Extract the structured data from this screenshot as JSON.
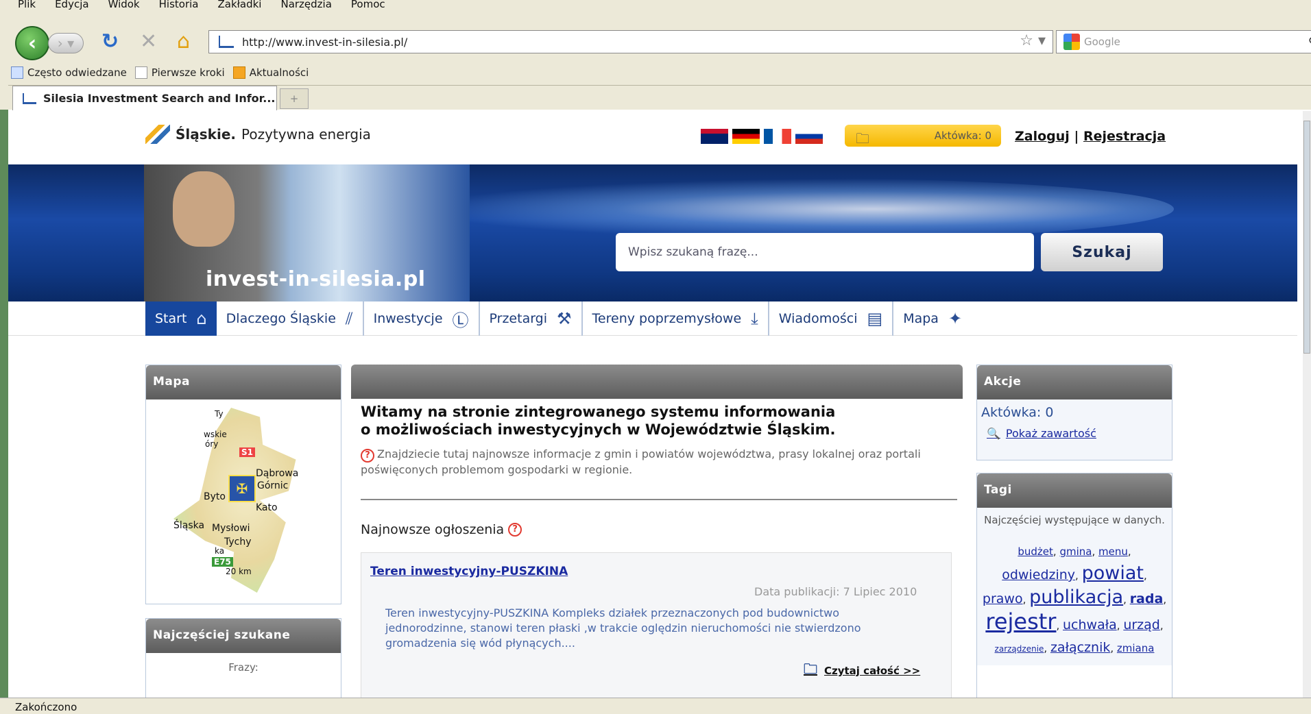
{
  "browser": {
    "menu": [
      "Plik",
      "Edycja",
      "Widok",
      "Historia",
      "Zakładki",
      "Narzędzia",
      "Pomoc"
    ],
    "url": "http://www.invest-in-silesia.pl/",
    "search_placeholder": "Google",
    "bookmarks": [
      "Często odwiedzane",
      "Pierwsze kroki",
      "Aktualności"
    ],
    "tab_title": "Silesia Investment Search and Infor...",
    "status": "Zakończono"
  },
  "header": {
    "logo_bold": "Śląskie.",
    "logo_rest": " Pozytywna energia",
    "aktowka": "Aktówka: 0",
    "login": "Zaloguj",
    "separator": "|",
    "register": "Rejestracja",
    "site_name": "invest-in-silesia.pl",
    "search_placeholder": "Wpisz szukaną frazę...",
    "search_button": "Szukaj"
  },
  "nav": [
    "Start",
    "Dlaczego Śląskie",
    "Inwestycje",
    "Przetargi",
    "Tereny poprzemysłowe",
    "Wiadomości",
    "Mapa"
  ],
  "mapa": {
    "title": "Mapa",
    "labels": [
      "Dąbrowa",
      "Górnic",
      "Byto",
      "Kato",
      "Śląska",
      "Mysłowi",
      "Tychy",
      "20 km",
      "S1",
      "E75",
      "wskie",
      "óry",
      "Ty",
      "ka"
    ]
  },
  "najczesciej": {
    "title": "Najczęściej szukane",
    "label": "Frazy:"
  },
  "main": {
    "welcome_line1": "Witamy na stronie zintegrowanego systemu informowania",
    "welcome_line2": "o możliwościach inwestycyjnych w Województwie Śląskim.",
    "welcome_sub": "Znajdziecie tutaj najnowsze informacje z gmin i powiatów województwa, prasy lokalnej oraz portali poświęconych problemom gospodarki w regionie.",
    "newest": "Najnowsze ogłoszenia",
    "ann_title": "Teren inwestycyjny-PUSZKINA",
    "ann_date": "Data publikacji: 7 Lipiec 2010",
    "ann_text": "Teren inwestycyjny-PUSZKINA Kompleks działek przeznaczonych pod budownictwo jednorodzinne, stanowi teren płaski ,w trakcie oględzin nieruchomości nie stwierdzono gromadzenia się wód płynących....",
    "read_more": "Czytaj całość >>"
  },
  "akcje": {
    "title": "Akcje",
    "aktowka": "Aktówka: 0",
    "show": "Pokaż zawartość"
  },
  "tagi": {
    "title": "Tagi",
    "desc": "Najczęściej występujące w danych.",
    "tags": [
      {
        "t": "budżet",
        "s": "small"
      },
      {
        "t": "gmina",
        "s": "small"
      },
      {
        "t": "menu",
        "s": "small"
      },
      {
        "t": "odwiedziny",
        "s": "medium"
      },
      {
        "t": "powiat",
        "s": "large"
      },
      {
        "t": "prawo",
        "s": "medium"
      },
      {
        "t": "publikacja",
        "s": "large"
      },
      {
        "t": "rada",
        "s": "medium"
      },
      {
        "t": "rejestr",
        "s": "xlarge"
      },
      {
        "t": "uchwała",
        "s": "medium"
      },
      {
        "t": "urząd",
        "s": "medium"
      },
      {
        "t": "zarządzenie",
        "s": "tiny"
      },
      {
        "t": "załącznik",
        "s": "medium"
      },
      {
        "t": "zmiana",
        "s": "small"
      }
    ]
  }
}
